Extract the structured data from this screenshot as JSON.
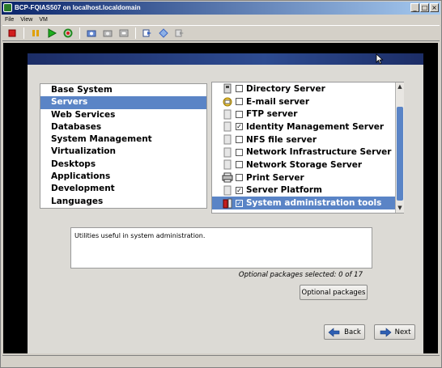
{
  "window": {
    "title": "BCP-FQIAS507 on localhost.localdomain",
    "controls": [
      "_",
      "□",
      "×"
    ]
  },
  "menu": {
    "items": [
      "File",
      "View",
      "VM"
    ]
  },
  "toolbar": {
    "icons": [
      "stop-icon",
      "pause-icon",
      "play-icon",
      "reset-icon",
      "snapshot-icon",
      "revert-icon",
      "manage-snapshots-icon",
      "fullscreen-icon",
      "unity-icon",
      "quick-switch-icon"
    ]
  },
  "installer": {
    "categories": [
      {
        "label": "Base System",
        "selected": false
      },
      {
        "label": "Servers",
        "selected": true
      },
      {
        "label": "Web Services",
        "selected": false
      },
      {
        "label": "Databases",
        "selected": false
      },
      {
        "label": "System Management",
        "selected": false
      },
      {
        "label": "Virtualization",
        "selected": false
      },
      {
        "label": "Desktops",
        "selected": false
      },
      {
        "label": "Applications",
        "selected": false
      },
      {
        "label": "Development",
        "selected": false
      },
      {
        "label": "Languages",
        "selected": false
      }
    ],
    "groups": [
      {
        "label": "Directory Server",
        "checked": false,
        "icon": "directory-server-icon",
        "selected": false
      },
      {
        "label": "E-mail server",
        "checked": false,
        "icon": "email-server-icon",
        "selected": false
      },
      {
        "label": "FTP server",
        "checked": false,
        "icon": "ftp-server-icon",
        "selected": false
      },
      {
        "label": "Identity Management Server",
        "checked": true,
        "icon": "identity-server-icon",
        "selected": false
      },
      {
        "label": "NFS file server",
        "checked": false,
        "icon": "nfs-server-icon",
        "selected": false
      },
      {
        "label": "Network Infrastructure Server",
        "checked": false,
        "icon": "network-server-icon",
        "selected": false
      },
      {
        "label": "Network Storage Server",
        "checked": false,
        "icon": "storage-server-icon",
        "selected": false
      },
      {
        "label": "Print Server",
        "checked": false,
        "icon": "printer-icon",
        "selected": false
      },
      {
        "label": "Server Platform",
        "checked": true,
        "icon": "server-platform-icon",
        "selected": false
      },
      {
        "label": "System administration tools",
        "checked": true,
        "icon": "admin-tools-icon",
        "selected": true
      }
    ],
    "description": "Utilities useful in system administration.",
    "optional_status": "Optional packages selected: 0 of 17",
    "optional_button": "Optional packages",
    "back_button": "Back",
    "next_button": "Next"
  }
}
